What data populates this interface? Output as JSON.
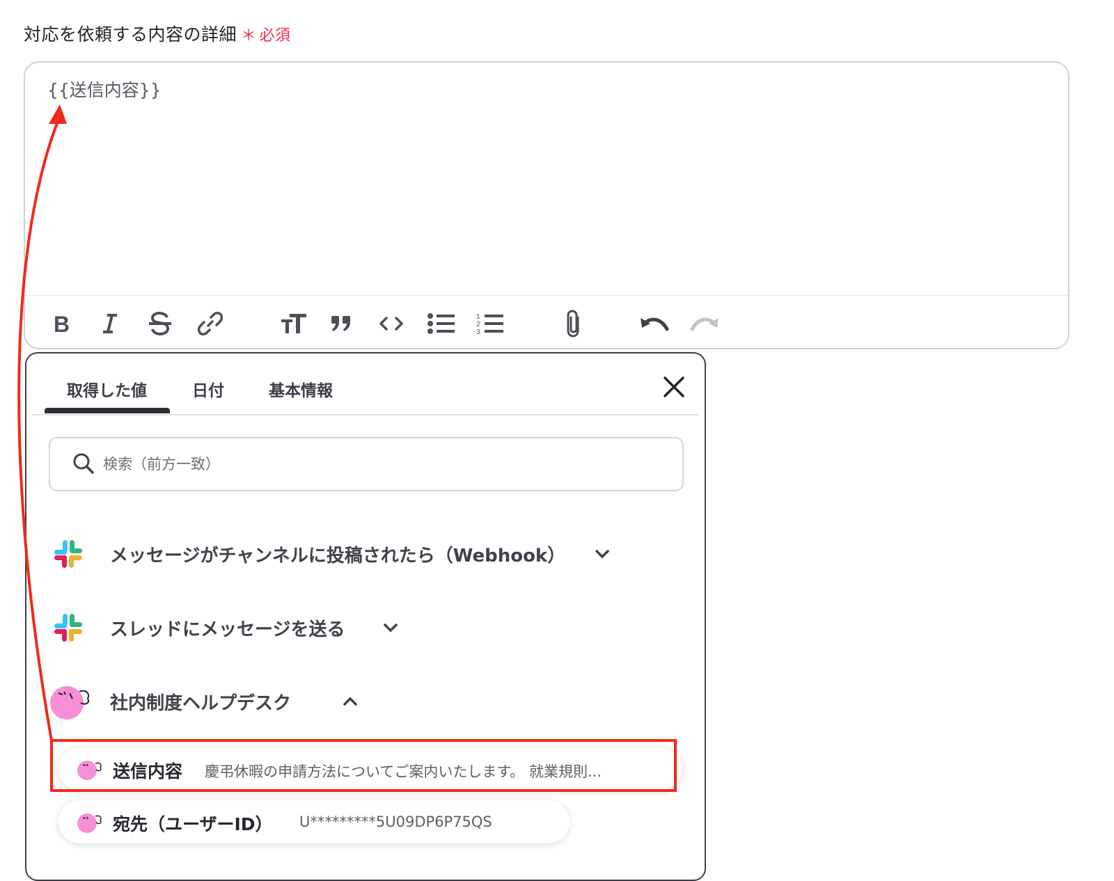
{
  "field": {
    "label": "対応を依頼する内容の詳細",
    "required_mark": "＊",
    "required_text": "必須",
    "value": "{{送信内容}}"
  },
  "toolbar": {
    "buttons": [
      "bold-icon",
      "italic-icon",
      "strikethrough-icon",
      "link-icon",
      "text-size-icon",
      "quote-icon",
      "code-icon",
      "bullet-list-icon",
      "numbered-list-icon",
      "attachment-icon",
      "undo-icon",
      "redo-icon"
    ]
  },
  "picker": {
    "tabs": [
      {
        "label": "取得した値",
        "active": true
      },
      {
        "label": "日付",
        "active": false
      },
      {
        "label": "基本情報",
        "active": false
      }
    ],
    "search_placeholder": "検索（前方一致）",
    "groups": [
      {
        "label": "メッセージがチャンネルに投稿されたら（Webhook）",
        "icon": "slack-icon",
        "expanded": false
      },
      {
        "label": "スレッドにメッセージを送る",
        "icon": "slack-icon",
        "expanded": false
      },
      {
        "label": "社内制度ヘルプデスク",
        "icon": "helpdesk-icon",
        "expanded": true
      }
    ],
    "items": [
      {
        "name": "送信内容",
        "value": "慶弔休暇の申請方法についてご案内いたします。 就業規則..."
      },
      {
        "name": "宛先（ユーザーID）",
        "value": "U*********5U09DP6P75QS"
      }
    ]
  },
  "colors": {
    "required": "#e8304f",
    "annotation": "#f4281b",
    "tab_active": "#2b3036",
    "slack_blue": "#36c5f0",
    "slack_green": "#2eb67d",
    "slack_yellow": "#ecb22e",
    "slack_red": "#e01e5a",
    "helpdesk_pink": "#f78fd6"
  }
}
